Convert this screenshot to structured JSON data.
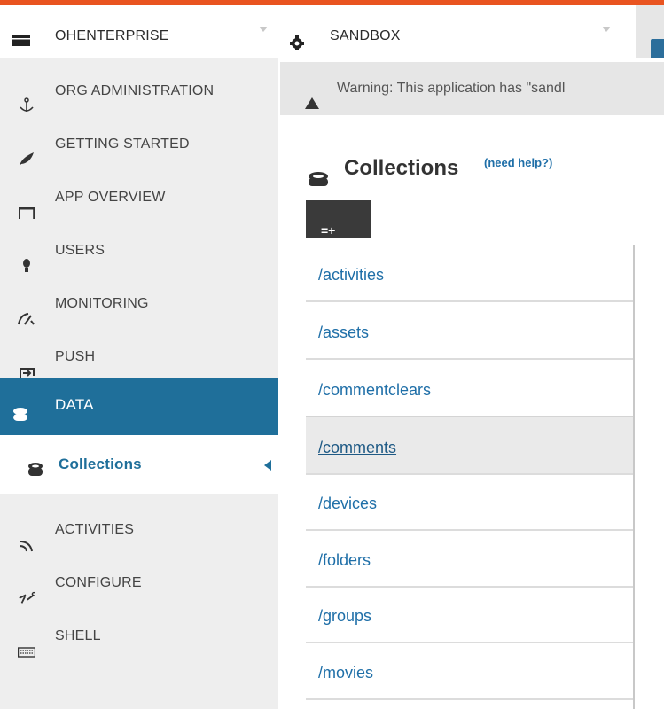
{
  "header": {
    "org_selector": {
      "label": "OHENTERPRISE",
      "icon": "briefcase-icon"
    },
    "app_selector": {
      "label": "SANDBOX",
      "icon": "gear-icon"
    },
    "accent_color": "#e95420"
  },
  "sidebar": {
    "items": [
      {
        "label": "ORG ADMINISTRATION",
        "icon": "anchor-icon"
      },
      {
        "label": "GETTING STARTED",
        "icon": "rocket-icon"
      },
      {
        "label": "APP OVERVIEW",
        "icon": "table-icon"
      },
      {
        "label": "USERS",
        "icon": "user-icon"
      },
      {
        "label": "MONITORING",
        "icon": "gauge-icon"
      },
      {
        "label": "PUSH",
        "icon": "push-icon"
      },
      {
        "label": "DATA",
        "icon": "database-icon",
        "active": true
      },
      {
        "label": "Collections",
        "icon": "collections-icon",
        "sub": true
      },
      {
        "label": "ACTIVITIES",
        "icon": "rss-icon"
      },
      {
        "label": "CONFIGURE",
        "icon": "wrench-icon"
      },
      {
        "label": "SHELL",
        "icon": "keyboard-icon"
      }
    ],
    "active_color": "#1f6f9a"
  },
  "warning": {
    "text": "Warning: This application has \"sandl"
  },
  "main": {
    "title": "Collections",
    "help_link": "(need help?)",
    "add_button": "=+",
    "collections": [
      "/activities",
      "/assets",
      "/commentclears",
      "/comments",
      "/devices",
      "/folders",
      "/groups",
      "/movies"
    ],
    "selected": "/comments"
  }
}
